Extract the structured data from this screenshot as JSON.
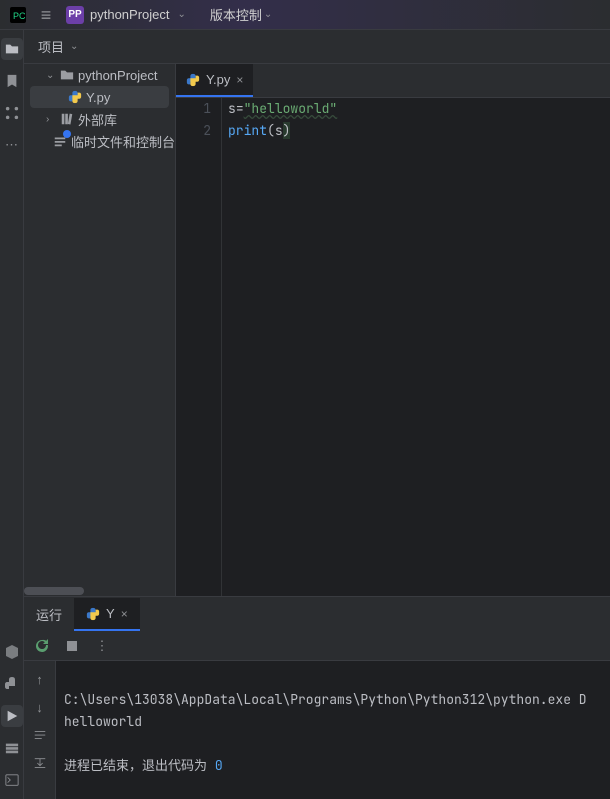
{
  "titlebar": {
    "project_badge": "PP",
    "project_name": "pythonProject",
    "vcs_label": "版本控制"
  },
  "project_tool": {
    "label": "项目"
  },
  "tree": {
    "root": "pythonProject",
    "file": "Y.py",
    "ext_libs": "外部库",
    "scratches": "临时文件和控制台"
  },
  "editor": {
    "tab_file": "Y.py",
    "gutter": [
      "1",
      "2"
    ],
    "lines": [
      {
        "var": "s",
        "op": "=",
        "str": "\"helloworld\""
      },
      {
        "fn": "print",
        "paren_open": "(",
        "arg": "s",
        "paren_close": ")"
      }
    ]
  },
  "run": {
    "tab_run": "运行",
    "tab_config": "Y",
    "console_line1": "C:\\Users\\13038\\AppData\\Local\\Programs\\Python\\Python312\\python.exe D",
    "console_line2": "helloworld",
    "console_exit_prefix": "进程已结束，退出代码为 ",
    "console_exit_code": "0"
  }
}
